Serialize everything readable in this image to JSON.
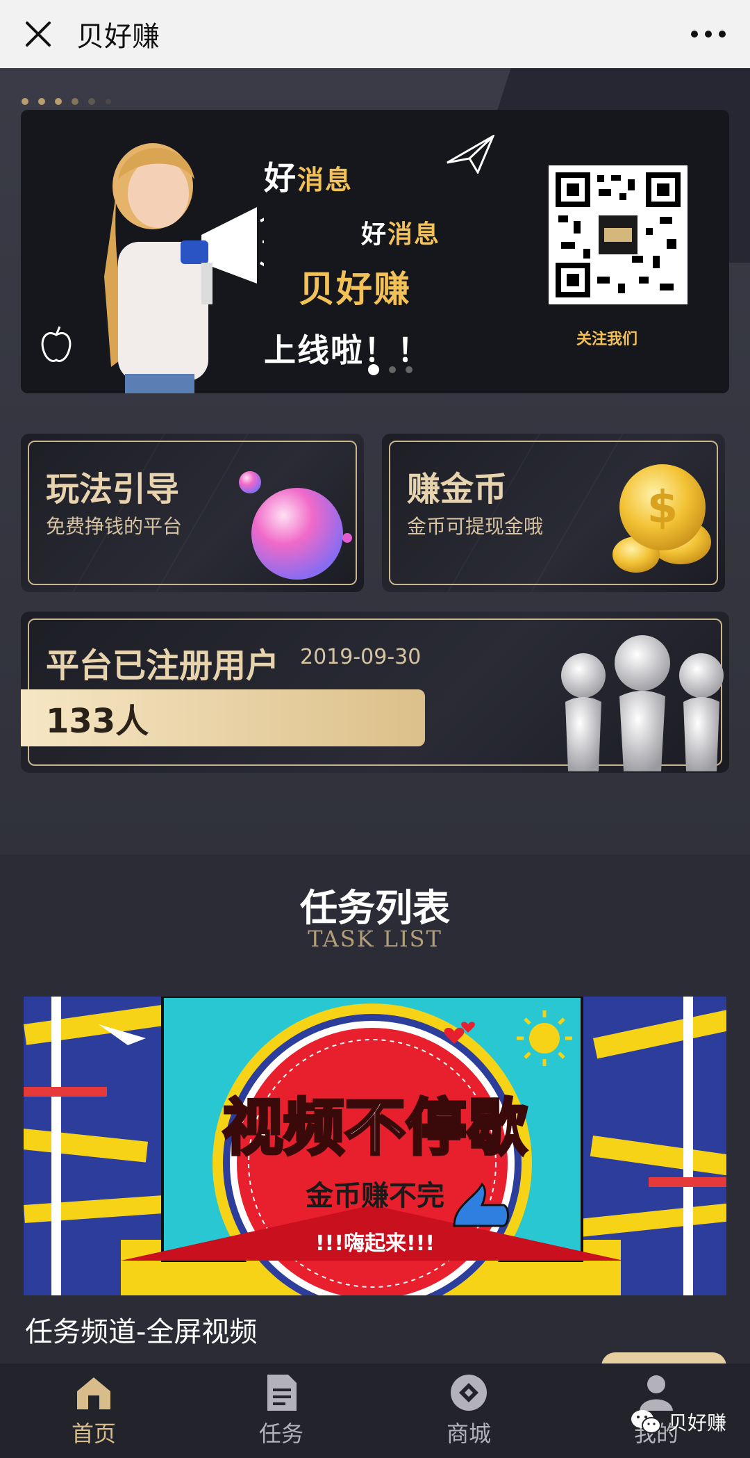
{
  "topbar": {
    "title": "贝好赚",
    "close_icon": "close-icon",
    "more_icon": "more-icon"
  },
  "banner": {
    "headline_1_a": "好",
    "headline_1_b": "消息",
    "headline_2_a": "好",
    "headline_2_b": "消息",
    "headline_3": "贝好赚",
    "headline_4": "上线啦！！",
    "qr_caption": "关注我们",
    "page_count": 3,
    "active_page": 1
  },
  "cards": {
    "guide": {
      "title": "玩法引导",
      "subtitle": "免费挣钱的平台"
    },
    "coin": {
      "title": "赚金币",
      "subtitle": "金币可提现金哦"
    },
    "users": {
      "title": "平台已注册用户",
      "date": "2019-09-30",
      "count": "133人"
    }
  },
  "task_section": {
    "title": "任务列表",
    "subtitle": "TASK LIST",
    "items": [
      {
        "banner_title": "视频不停歇",
        "banner_sub": "金币赚不完",
        "banner_tag": "!!!嗨起来!!!",
        "name": "任务频道-全屏视频"
      }
    ]
  },
  "tabbar": {
    "tabs": [
      {
        "label": "首页",
        "icon": "home-icon",
        "active": true
      },
      {
        "label": "任务",
        "icon": "document-icon",
        "active": false
      },
      {
        "label": "商城",
        "icon": "shop-icon",
        "active": false
      },
      {
        "label": "我的",
        "icon": "user-icon",
        "active": false
      }
    ]
  },
  "watermark": {
    "text": "贝好赚",
    "icon": "wechat-icon"
  },
  "colors": {
    "gold": "#d8bd8a",
    "background": "#2b2c36",
    "topbar": "#f2f2f2"
  }
}
